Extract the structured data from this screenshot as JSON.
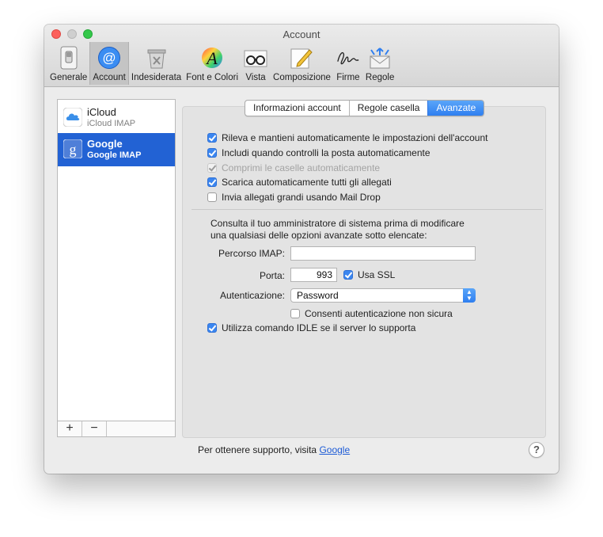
{
  "window": {
    "title": "Account"
  },
  "toolbar": {
    "items": [
      {
        "label": "Generale",
        "icon": "switch-icon"
      },
      {
        "label": "Account",
        "icon": "at-sign-icon"
      },
      {
        "label": "Indesiderata",
        "icon": "junk-trash-icon"
      },
      {
        "label": "Font e Colori",
        "icon": "font-colors-icon"
      },
      {
        "label": "Vista",
        "icon": "glasses-icon"
      },
      {
        "label": "Composizione",
        "icon": "pencil-icon"
      },
      {
        "label": "Firme",
        "icon": "signature-icon"
      },
      {
        "label": "Regole",
        "icon": "rules-envelope-icon"
      }
    ],
    "active_index": 1
  },
  "sidebar": {
    "accounts": [
      {
        "name": "iCloud",
        "type": "iCloud IMAP",
        "icon": "icloud-icon",
        "selected": false
      },
      {
        "name": "Google",
        "type": "Google IMAP",
        "icon": "google-icon",
        "selected": true
      }
    ],
    "add_label": "+",
    "remove_label": "−"
  },
  "tabs": [
    {
      "label": "Informazioni account",
      "selected": false
    },
    {
      "label": "Regole casella",
      "selected": false
    },
    {
      "label": "Avanzate",
      "selected": true
    }
  ],
  "options": {
    "auto_detect": {
      "label": "Rileva e mantieni automaticamente le impostazioni dell'account",
      "checked": true,
      "enabled": true
    },
    "include_check": {
      "label": "Includi quando controlli la posta automaticamente",
      "checked": true,
      "enabled": true
    },
    "compact": {
      "label": "Comprimi le caselle automaticamente",
      "checked": true,
      "enabled": false
    },
    "download_attachments": {
      "label": "Scarica automaticamente tutti gli allegati",
      "checked": true,
      "enabled": true
    },
    "mail_drop": {
      "label": "Invia allegati grandi usando Mail Drop",
      "checked": false,
      "enabled": true
    }
  },
  "advanced": {
    "note_line1": "Consulta il tuo amministratore di sistema prima di modificare",
    "note_line2": "una qualsiasi delle opzioni avanzate sotto elencate:",
    "imap_path_label": "Percorso IMAP:",
    "imap_path_value": "",
    "port_label": "Porta:",
    "port_value": "993",
    "ssl_label": "Usa SSL",
    "ssl_checked": true,
    "auth_label": "Autenticazione:",
    "auth_value": "Password",
    "insecure_auth_label": "Consenti autenticazione non sicura",
    "insecure_auth_checked": false,
    "idle_label": "Utilizza comando IDLE se il server lo supporta",
    "idle_checked": true
  },
  "footer": {
    "support_text": "Per ottenere supporto, visita",
    "support_link": "Google",
    "help_label": "?"
  },
  "colors": {
    "accent": "#2f7ff0",
    "selection": "#2262d4",
    "close": "#fc605c",
    "zoom": "#34c84a"
  }
}
